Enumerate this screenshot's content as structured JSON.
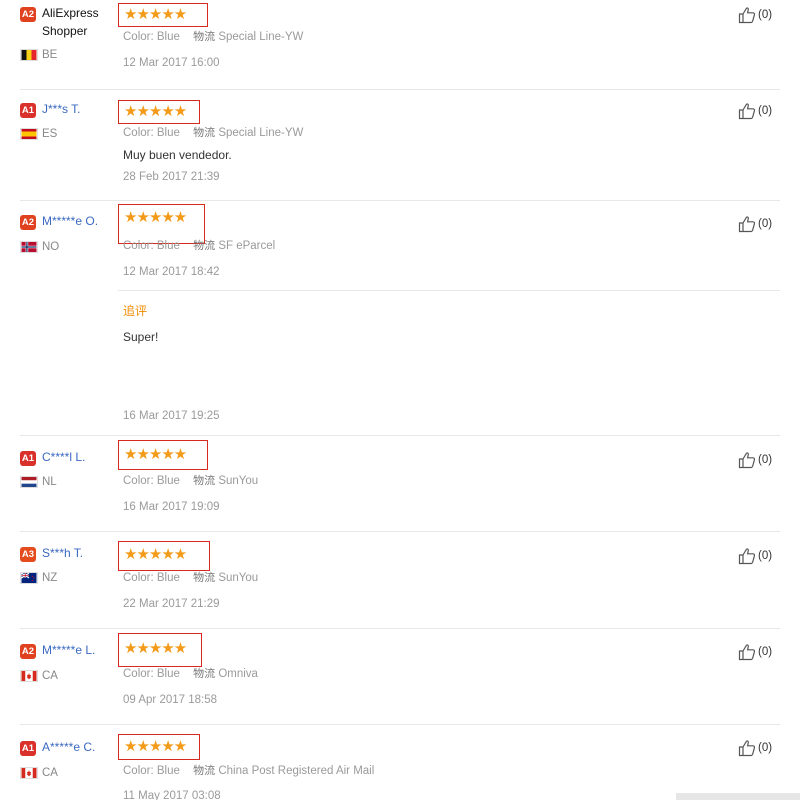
{
  "reviews": [
    {
      "badge": "A2",
      "name": "AliExpress Shopper",
      "country": "BE",
      "rating_stars": "★★★★★",
      "rating": 5,
      "color_key": "Color:",
      "color_val": "Blue",
      "logistics_key": "物流",
      "logistics_val": "Special Line-YW",
      "text": "",
      "date": "12 Mar 2017 16:00",
      "helpful": "(0)"
    },
    {
      "badge": "A1",
      "name": "J***s T.",
      "country": "ES",
      "rating_stars": "★★★★★",
      "rating": 5,
      "color_key": "Color:",
      "color_val": "Blue",
      "logistics_key": "物流",
      "logistics_val": "Special Line-YW",
      "text": "Muy buen vendedor.",
      "date": "28 Feb 2017 21:39",
      "helpful": "(0)"
    },
    {
      "badge": "A2",
      "name": "M*****e O.",
      "country": "NO",
      "rating_stars": "★★★★★",
      "rating": 5,
      "color_key": "Color:",
      "color_val": "Blue",
      "logistics_key": "物流",
      "logistics_val": "SF eParcel",
      "text": "",
      "date": "12 Mar 2017 18:42",
      "append_label": "追评",
      "append_text": "Super!",
      "append_date": "16 Mar 2017 19:25",
      "helpful": "(0)"
    },
    {
      "badge": "A1",
      "name": "C****l L.",
      "country": "NL",
      "rating_stars": "★★★★★",
      "rating": 5,
      "color_key": "Color:",
      "color_val": "Blue",
      "logistics_key": "物流",
      "logistics_val": "SunYou",
      "text": "",
      "date": "16 Mar 2017 19:09",
      "helpful": "(0)"
    },
    {
      "badge": "A3",
      "name": "S***h T.",
      "country": "NZ",
      "rating_stars": "★★★★★",
      "rating": 5,
      "color_key": "Color:",
      "color_val": "Blue",
      "logistics_key": "物流",
      "logistics_val": "SunYou",
      "text": "",
      "date": "22 Mar 2017 21:29",
      "helpful": "(0)"
    },
    {
      "badge": "A2",
      "name": "M*****e L.",
      "country": "CA",
      "rating_stars": "★★★★★",
      "rating": 5,
      "color_key": "Color:",
      "color_val": "Blue",
      "logistics_key": "物流",
      "logistics_val": "Omniva",
      "text": "",
      "date": "09 Apr 2017 18:58",
      "helpful": "(0)"
    },
    {
      "badge": "A1",
      "name": "A*****e C.",
      "country": "CA",
      "rating_stars": "★★★★★",
      "rating": 5,
      "color_key": "Color:",
      "color_val": "Blue",
      "logistics_key": "物流",
      "logistics_val": "China Post Registered Air Mail",
      "text": "",
      "date": "11 May 2017 03:08",
      "helpful": "(0)"
    }
  ],
  "colors": {
    "star": "#f39a18",
    "highlight_box": "#d8291c",
    "name_link": "#3a69c1",
    "append_label": "#f18b00"
  }
}
